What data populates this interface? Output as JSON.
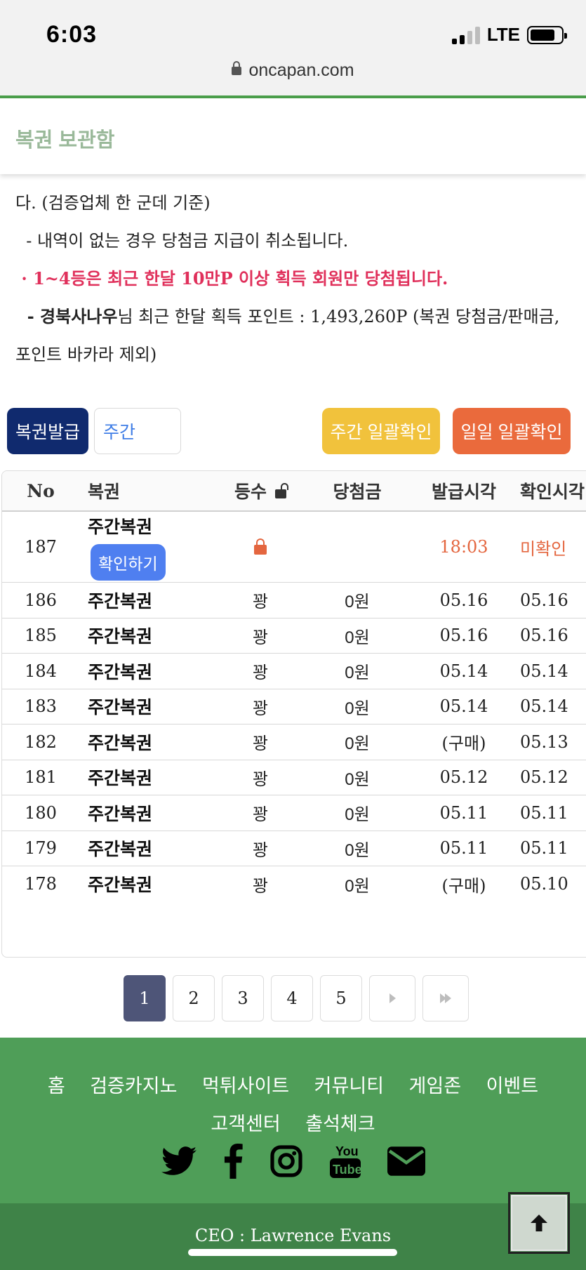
{
  "status": {
    "time": "6:03",
    "network": "LTE"
  },
  "browser": {
    "url": "oncapan.com"
  },
  "page": {
    "title": "복권 보관함"
  },
  "notice": {
    "line1": "다. (검증업체 한 군데 기준)",
    "line2": "  - 내역이 없는 경우 당첨금 지급이 취소됩니다.",
    "line3_prefix": " · ",
    "line3": "1~4등은 최근 한달 10만P 이상 획득 회원만 당첨됩니다.",
    "line4_prefix": "  - ",
    "line4_user": "경북사나우",
    "line4_rest": "님 최근 한달 획득 포인트 : 1,493,260P (복권 당첨금/판매금,",
    "line5": "포인트 바카라 제외)"
  },
  "controls": {
    "issue_button": "복권발급",
    "period_select": "주간",
    "weekly_check_button": "주간 일괄확인",
    "daily_check_button": "일일 일괄확인"
  },
  "table": {
    "headers": {
      "no": "No",
      "lottery": "복권",
      "rank": "등수",
      "prize": "당첨금",
      "issued": "발급시각",
      "checked": "확인시각"
    },
    "first_row": {
      "no": "187",
      "lottery": "주간복권",
      "confirm_button": "확인하기",
      "issued": "18:03",
      "checked": "미확인"
    },
    "rows": [
      {
        "no": "186",
        "lottery": "주간복권",
        "rank": "꽝",
        "prize": "0원",
        "issued": "05.16",
        "checked": "05.16"
      },
      {
        "no": "185",
        "lottery": "주간복권",
        "rank": "꽝",
        "prize": "0원",
        "issued": "05.16",
        "checked": "05.16"
      },
      {
        "no": "184",
        "lottery": "주간복권",
        "rank": "꽝",
        "prize": "0원",
        "issued": "05.14",
        "checked": "05.14"
      },
      {
        "no": "183",
        "lottery": "주간복권",
        "rank": "꽝",
        "prize": "0원",
        "issued": "05.14",
        "checked": "05.14"
      },
      {
        "no": "182",
        "lottery": "주간복권",
        "rank": "꽝",
        "prize": "0원",
        "issued": "(구매)",
        "checked": "05.13"
      },
      {
        "no": "181",
        "lottery": "주간복권",
        "rank": "꽝",
        "prize": "0원",
        "issued": "05.12",
        "checked": "05.12"
      },
      {
        "no": "180",
        "lottery": "주간복권",
        "rank": "꽝",
        "prize": "0원",
        "issued": "05.11",
        "checked": "05.11"
      },
      {
        "no": "179",
        "lottery": "주간복권",
        "rank": "꽝",
        "prize": "0원",
        "issued": "05.11",
        "checked": "05.11"
      },
      {
        "no": "178",
        "lottery": "주간복권",
        "rank": "꽝",
        "prize": "0원",
        "issued": "(구매)",
        "checked": "05.10"
      }
    ]
  },
  "pagination": {
    "pages": [
      "1",
      "2",
      "3",
      "4",
      "5"
    ],
    "current": "1"
  },
  "footer": {
    "nav": [
      "홈",
      "검증카지노",
      "먹튀사이트",
      "커뮤니티",
      "게임존",
      "이벤트",
      "고객센터",
      "출석체크"
    ],
    "social_icons": [
      "twitter-icon",
      "facebook-icon",
      "instagram-icon",
      "youtube-icon",
      "mail-icon"
    ],
    "ceo": "CEO : Lawrence Evans"
  },
  "colors": {
    "primary_green": "#4f9e58",
    "navy": "#102a6e",
    "yellow": "#f1c23c",
    "orange": "#ea6a3c",
    "red_notice": "#e0305b"
  }
}
